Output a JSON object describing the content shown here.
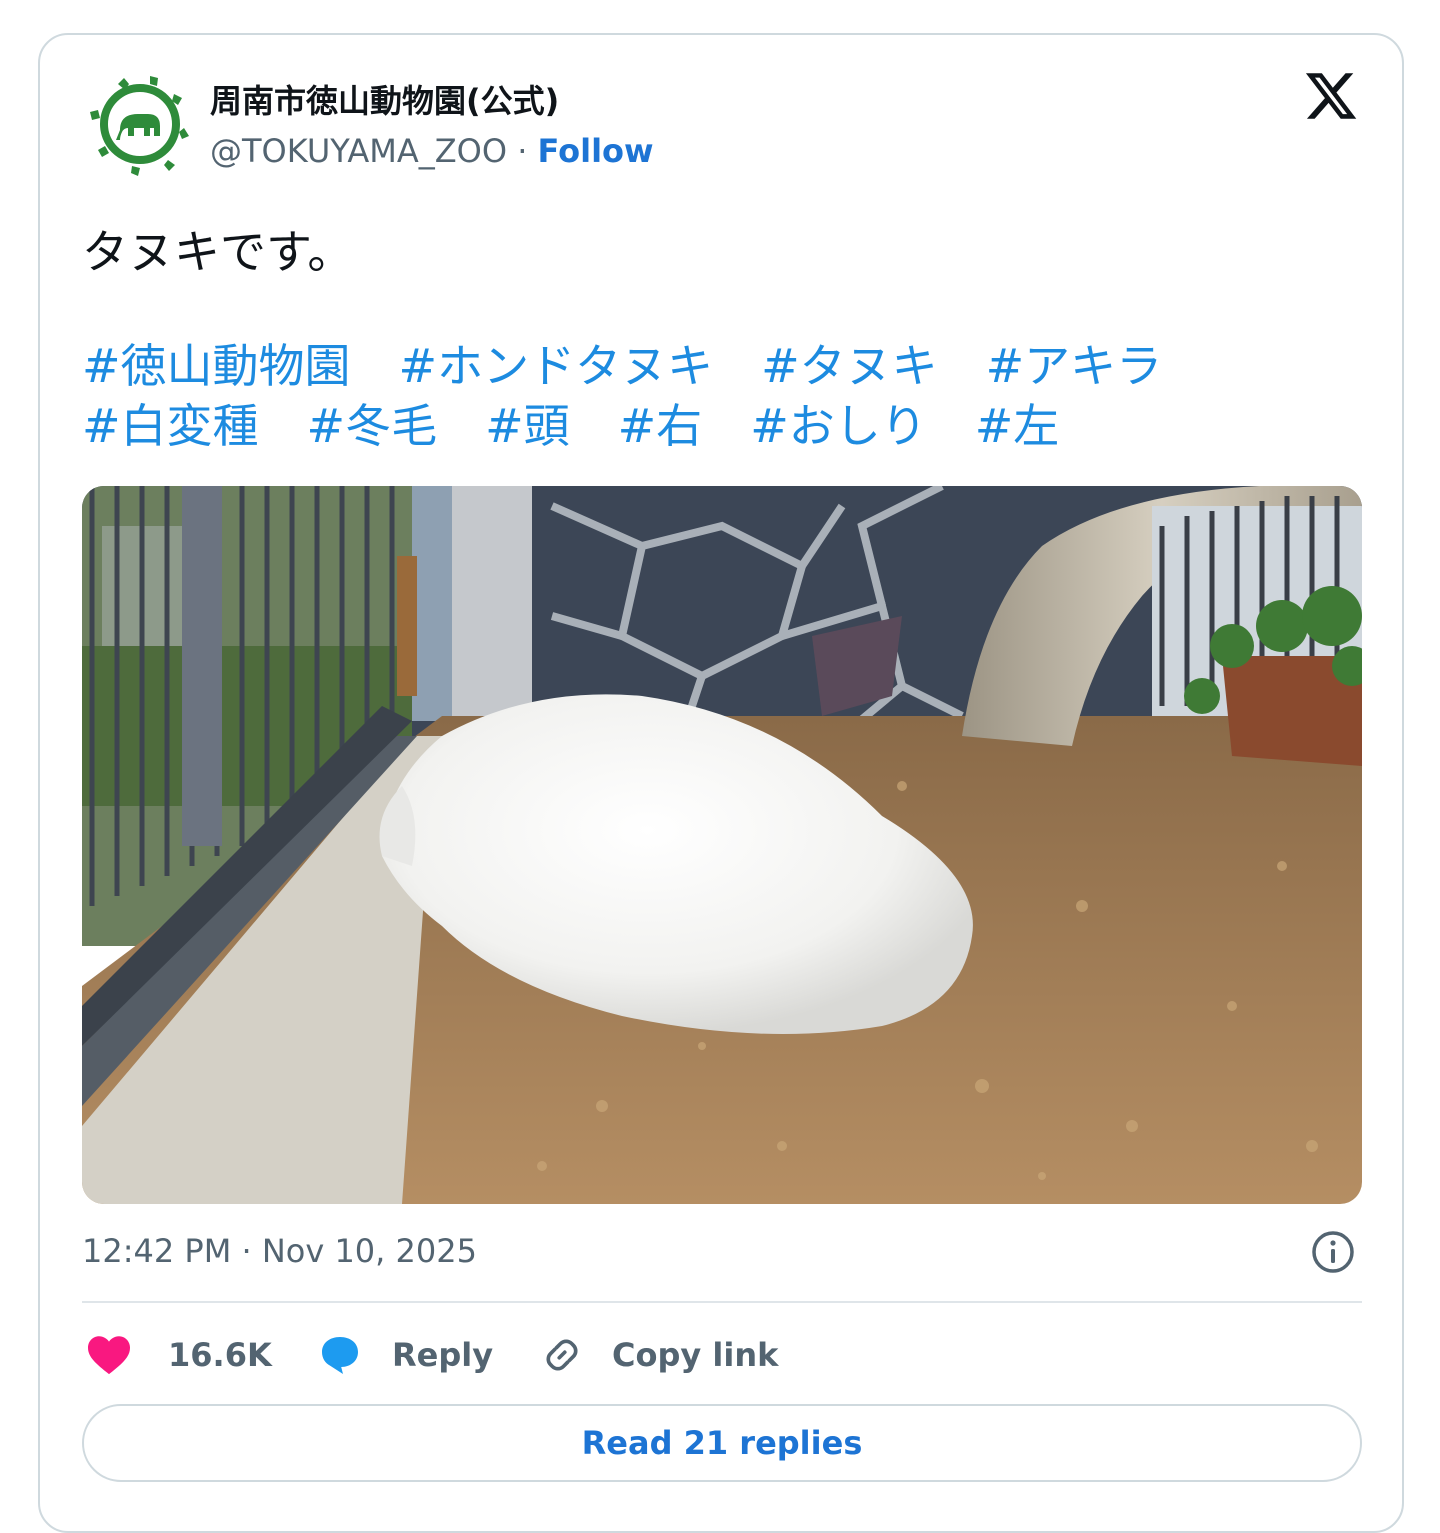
{
  "account": {
    "name": "周南市徳山動物園(公式)",
    "handle": "@TOKUYAMA_ZOO",
    "separator": "·",
    "follow_label": "Follow",
    "avatar_icon": "zoo-elephant-logo-icon",
    "brand_color": "#2e8b3a"
  },
  "tweet": {
    "text": "タヌキです。",
    "hashtags": [
      "#徳山動物園",
      "#ホンドタヌキ",
      "#タヌキ",
      "#アキラ",
      "#白変種",
      "#冬毛",
      "#頭",
      "#右",
      "#おしり",
      "#左"
    ],
    "timestamp": "12:42 PM · Nov 10, 2025"
  },
  "actions": {
    "like_count": "16.6K",
    "reply_label": "Reply",
    "copy_link_label": "Copy link",
    "read_replies_label": "Read 21 replies"
  },
  "colors": {
    "like": "#f91880",
    "link": "#1d74d4",
    "hashtag": "#1d8be0",
    "reply_bubble": "#1d9bf0",
    "muted": "#536471"
  }
}
